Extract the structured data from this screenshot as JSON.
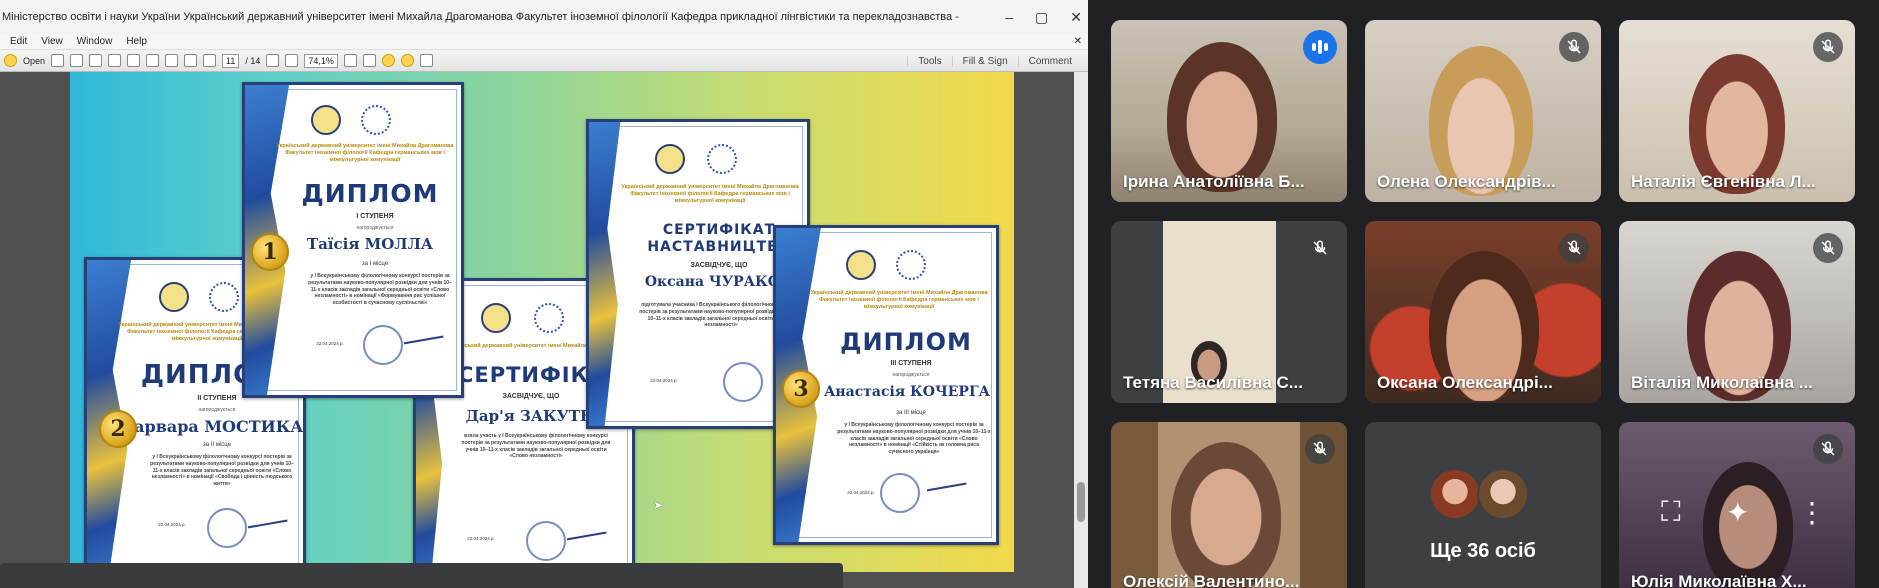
{
  "reader": {
    "title": "Міністерство освіти і науки України Український державний університет імені Михайла Драгоманова Факультет іноземної філології Кафедра прикладної лінгвістики та перекладознавства - Adobe Reader",
    "menu": [
      "Edit",
      "View",
      "Window",
      "Help"
    ],
    "toolbar": {
      "open_label": "Open",
      "page_current": "11",
      "page_total": "/ 14",
      "zoom": "74,1%",
      "tools": "Tools",
      "fill_sign": "Fill & Sign",
      "comment": "Comment"
    }
  },
  "certificates": [
    {
      "org": "Український державний університет імені Михайла Драгоманова Факультет іноземної філології Кафедра германських мов і міжкультурної комунікації",
      "heading": "ДИПЛОМ",
      "degree": "I СТУПЕНЯ",
      "awarded": "нагороджується",
      "name": "Таїсія МОЛЛА",
      "place": "за I місце",
      "body": "у I Всеукраїнському філологічному конкурсі постерів за результатами науково-популярної розвідки для учнів 10–11-х класів закладів загальної середньої освіти «Слово незламності» в номінації «Формування рис успішної особистості в сучасному суспільстві»",
      "date": "22.04.2024 р.",
      "medal": "1"
    },
    {
      "org": "Український державний університет імені Михайла Драгоманова Факультет іноземної філології Кафедра германських мов і міжкультурної комунікації",
      "heading": "ДИПЛОМ",
      "degree": "II СТУПЕНЯ",
      "awarded": "нагороджується",
      "name": "Варвара МОСТИКА",
      "place": "за II місце",
      "body": "у I Всеукраїнському філологічному конкурсі постерів за результатами науково-популярної розвідки для учнів 10–11-х класів закладів загальної середньої освіти «Слово незламності» в номінації «Свобода і цінність людського життя»",
      "date": "22.04.2024 р.",
      "medal": "2"
    },
    {
      "org": "Український державний університет імені Михайла Драгоманова",
      "heading": "СЕРТИФІКА",
      "degree": "ЗАСВІДЧУЄ, ЩО",
      "name": "Дар'я ЗАКУТНА",
      "body": "взяла участь у I Всеукраїнському філологічному конкурсі постерів за результатами науково-популярної розвідки для учнів 10–11-х класів закладів загальної середньої освіти «Слово незламності»",
      "date": "22.04.2024 р."
    },
    {
      "org": "Український державний університет імені Михайла Драгоманова Факультет іноземної філології Кафедра германських мов і міжкультурної комунікації",
      "heading": "СЕРТИФІКАТ НАСТАВНИЦТВА",
      "degree": "ЗАСВІДЧУЄ, ЩО",
      "name": "Оксана ЧУРАКОВА",
      "body": "підготувала учасника I Всеукраїнського філологічного конкурсу постерів за результатами науково-популярної розвідки для учнів 10–11-х класів закладів загальної середньої освіти «Слово незламності»",
      "date": "22.04.2024 р."
    },
    {
      "org": "Український державний університет імені Михайла Драгоманова Факультет іноземної філології Кафедра германських мов і міжкультурної комунікації",
      "heading": "ДИПЛОМ",
      "degree": "III СТУПЕНЯ",
      "awarded": "нагороджується",
      "name": "Анастасія КОЧЕРГА",
      "place": "за III місце",
      "body": "у I Всеукраїнському філологічному конкурсі постерів за результатами науково-популярної розвідки для учнів 10–11-х класів закладів загальної середньої освіти «Слово незламності» в номінації «Стійкість як головна риса сучасного українця»",
      "date": "22.04.2024 р.",
      "medal": "3"
    }
  ],
  "meet": {
    "participants": [
      {
        "name": "Ірина Анатоліївна Б...",
        "speaking": true
      },
      {
        "name": "Олена Олександрів...",
        "muted": true
      },
      {
        "name": "Наталія Євгенівна Л...",
        "muted": true
      },
      {
        "name": "Тетяна Василівна С...",
        "muted": true
      },
      {
        "name": "Оксана Олександрі...",
        "muted": true
      },
      {
        "name": "Віталія Миколаївна ...",
        "muted": true
      },
      {
        "name": "Олексій Валентино...",
        "muted": true
      },
      {
        "name": "Юлія Миколаївна Х...",
        "muted": true
      }
    ],
    "others_label": "Ще 36 осіб"
  },
  "colors": {
    "active_outline": "#8ab4f8",
    "speaking": "#1a73e8",
    "meet_bg": "#202124"
  }
}
